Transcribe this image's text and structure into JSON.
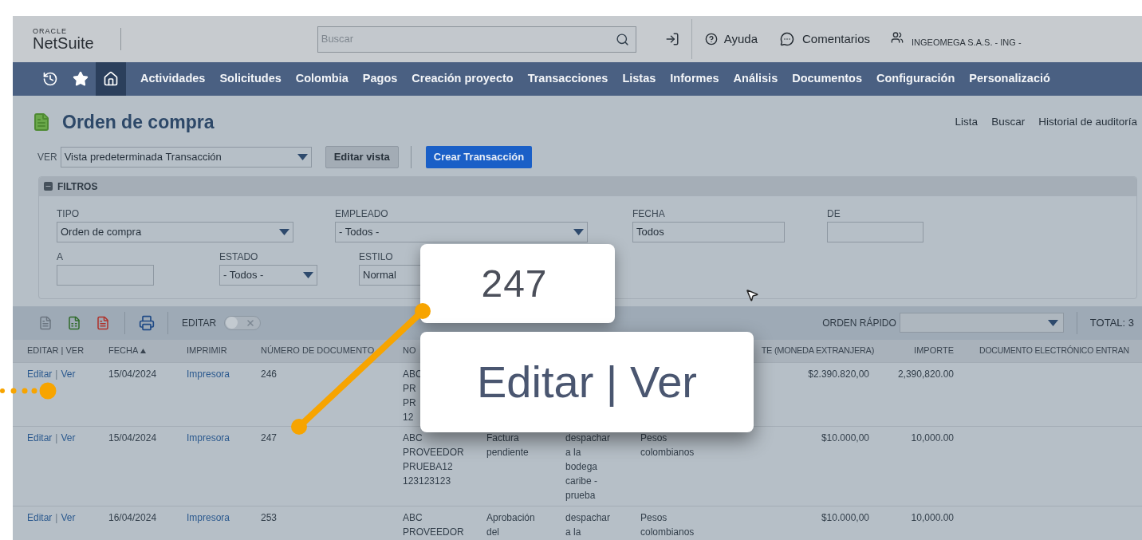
{
  "topbar": {
    "logo_small": "ORACLE",
    "logo": "NetSuite",
    "search": {
      "placeholder": "Buscar"
    },
    "help": "Ayuda",
    "feedback": "Comentarios",
    "account": "INGEOMEGA S.A.S. - ING -"
  },
  "nav": {
    "icons": [
      {
        "kind": "history",
        "selected": false
      },
      {
        "kind": "star",
        "selected": false
      },
      {
        "kind": "home",
        "selected": true
      }
    ],
    "items": [
      "Actividades",
      "Solicitudes",
      "Colombia",
      "Pagos",
      "Creación proyecto",
      "Transacciones",
      "Listas",
      "Informes",
      "Análisis",
      "Documentos",
      "Configuración",
      "Personalizació"
    ]
  },
  "page": {
    "title": "Orden de compra",
    "links": [
      "Lista",
      "Buscar",
      "Historial de auditoría"
    ],
    "view_label": "VER",
    "view_value": "Vista predeterminada Transacción",
    "edit_view": "Editar vista",
    "create": "Crear Transacción"
  },
  "filters": {
    "title": "FILTROS",
    "expanded": true,
    "row_1": [
      {
        "label": "TIPO",
        "value": "Orden de compra",
        "kind": "select"
      },
      {
        "label": "EMPLEADO",
        "value": "- Todos -",
        "kind": "select"
      },
      {
        "label": "FECHA",
        "value": "Todos",
        "kind": "text"
      },
      {
        "label": "DE",
        "kind": "text"
      }
    ],
    "row_2": [
      {
        "label": "A",
        "kind": "text"
      },
      {
        "label": "ESTADO",
        "value": "- Todos -",
        "kind": "select"
      },
      {
        "label": "ESTILO",
        "value": "Normal",
        "kind": "cut"
      }
    ]
  },
  "toolbar": {
    "edit_label": "EDITAR",
    "edit_on": false,
    "sort_label": "ORDEN RÁPIDO",
    "total": "TOTAL: 3"
  },
  "table": {
    "headers": {
      "editar_ver": "EDITAR | VER",
      "fecha": "FECHA",
      "imprimir": "IMPRIMIR",
      "numero": "NÚMERO DE DOCUMENTO",
      "column_5": "NO",
      "column_9": "TE (MONEDA EXTRANJERA)",
      "importe": "IMPORTE",
      "column_11": "DOCUMENTO ELECTRÓNICO ENTRAN"
    },
    "sorted_by_fecha": true,
    "rows": [
      {
        "edit": "Editar",
        "separator": "|",
        "view": "Ver",
        "fecha": "15/04/2024",
        "imprimir": "Impresora",
        "numero": "246",
        "nombre": [
          "ABC",
          "PR",
          "PR",
          "12"
        ],
        "importe_ext": "$2.390.820,00",
        "importe": "2,390,820.00"
      },
      {
        "edit": "Editar",
        "separator": "|",
        "view": "Ver",
        "fecha": "15/04/2024",
        "imprimir": "Impresora",
        "numero": "247",
        "nombre": [
          "ABC",
          "PROVEEDOR",
          "PRUEBA12",
          "123123123"
        ],
        "estado": [
          "Factura",
          "pendiente"
        ],
        "estilo": [
          "despachar",
          "a la",
          "bodega",
          "caribe -",
          "prueba"
        ],
        "moneda": [
          "Pesos",
          "colombianos"
        ],
        "importe_ext": "$10.000,00",
        "importe": "10,000.00"
      },
      {
        "edit": "Editar",
        "separator": "|",
        "view": "Ver",
        "fecha": "16/04/2024",
        "imprimir": "Impresora",
        "numero": "253",
        "nombre": [
          "ABC",
          "PROVEEDOR"
        ],
        "estado": [
          "Aprobación",
          "del"
        ],
        "estilo": [
          "despachar",
          "a la"
        ],
        "moneda": [
          "Pesos",
          "colombianos"
        ],
        "importe_ext": "$10.000,00",
        "importe": "10,000.00"
      }
    ]
  },
  "callouts": [
    {
      "text": "247"
    },
    {
      "text": "Editar | Ver"
    }
  ]
}
